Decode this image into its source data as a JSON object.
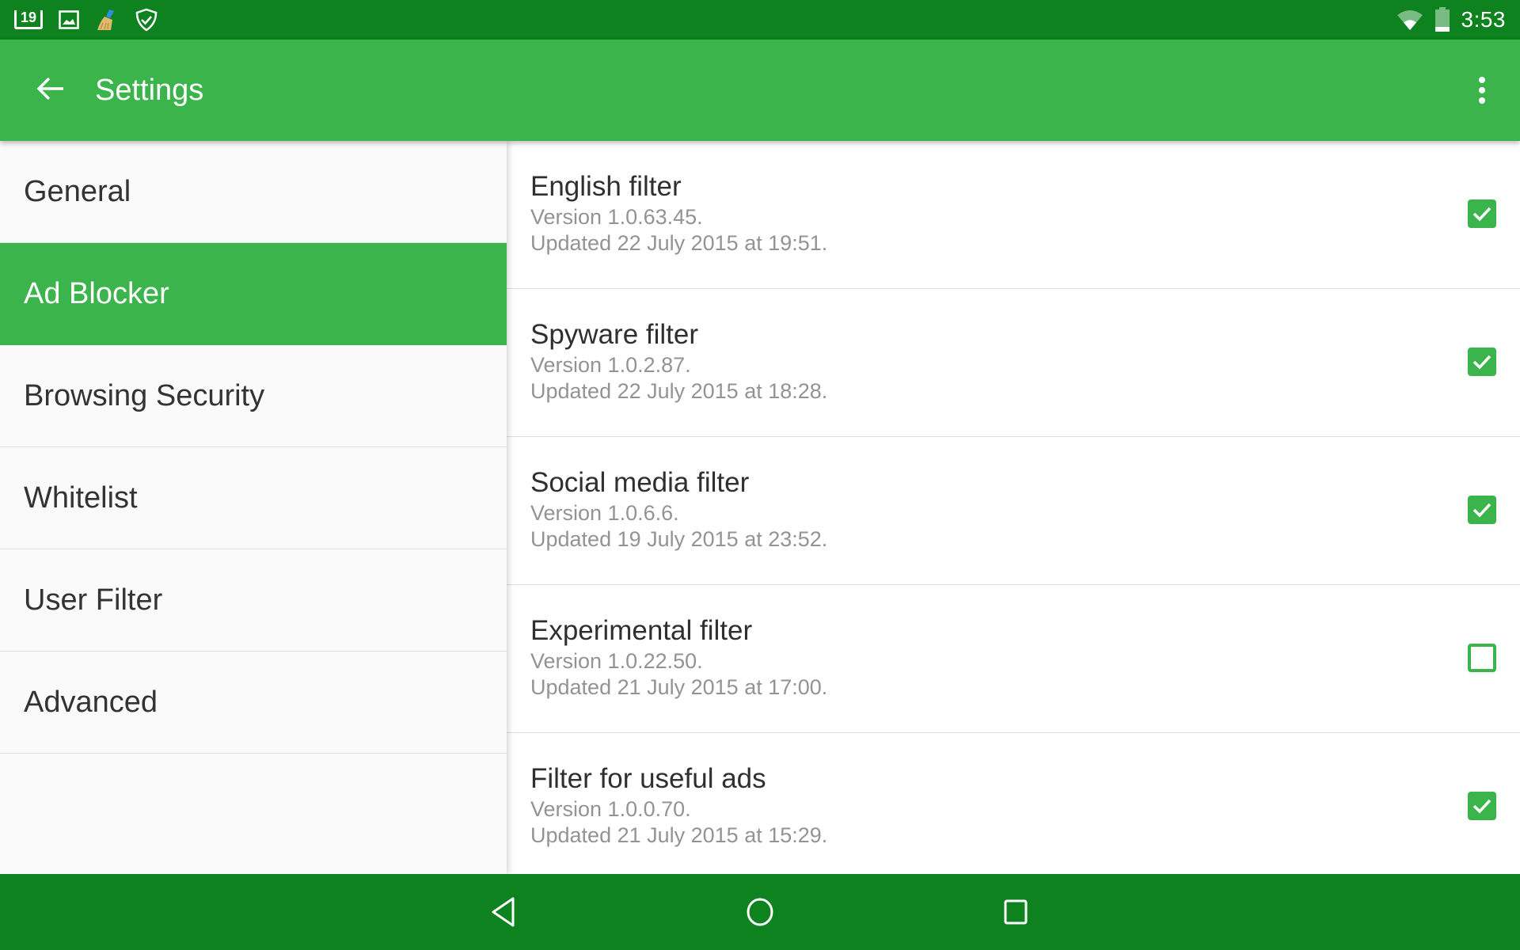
{
  "status_bar": {
    "notification_count": "19",
    "time": "3:53",
    "icons": [
      "notification-count-icon",
      "image-icon",
      "broom-cleaner-icon",
      "shield-check-icon",
      "wifi-icon",
      "battery-icon"
    ]
  },
  "toolbar": {
    "title": "Settings",
    "back_icon": "arrow-left-icon",
    "overflow_icon": "more-vert-icon"
  },
  "sidebar": {
    "items": [
      {
        "label": "General",
        "active": false
      },
      {
        "label": "Ad Blocker",
        "active": true
      },
      {
        "label": "Browsing Security",
        "active": false
      },
      {
        "label": "Whitelist",
        "active": false
      },
      {
        "label": "User Filter",
        "active": false
      },
      {
        "label": "Advanced",
        "active": false
      }
    ]
  },
  "filters": [
    {
      "title": "English filter",
      "version": "Version 1.0.63.45.",
      "updated": "Updated 22 July 2015 at 19:51.",
      "checked": true
    },
    {
      "title": "Spyware filter",
      "version": "Version 1.0.2.87.",
      "updated": "Updated 22 July 2015 at 18:28.",
      "checked": true
    },
    {
      "title": "Social media filter",
      "version": "Version 1.0.6.6.",
      "updated": "Updated 19 July 2015 at 23:52.",
      "checked": true
    },
    {
      "title": "Experimental filter",
      "version": "Version 1.0.22.50.",
      "updated": "Updated 21 July 2015 at 17:00.",
      "checked": false
    },
    {
      "title": "Filter for useful ads",
      "version": "Version 1.0.0.70.",
      "updated": "Updated 21 July 2015 at 15:29.",
      "checked": true
    }
  ],
  "nav_bar": {
    "buttons": [
      "back-triangle-icon",
      "home-circle-icon",
      "recents-square-icon"
    ]
  },
  "colors": {
    "status_bar": "#0d821e",
    "toolbar": "#3bb44c",
    "accent": "#3bb44c",
    "nav_bar": "#0d821e"
  }
}
